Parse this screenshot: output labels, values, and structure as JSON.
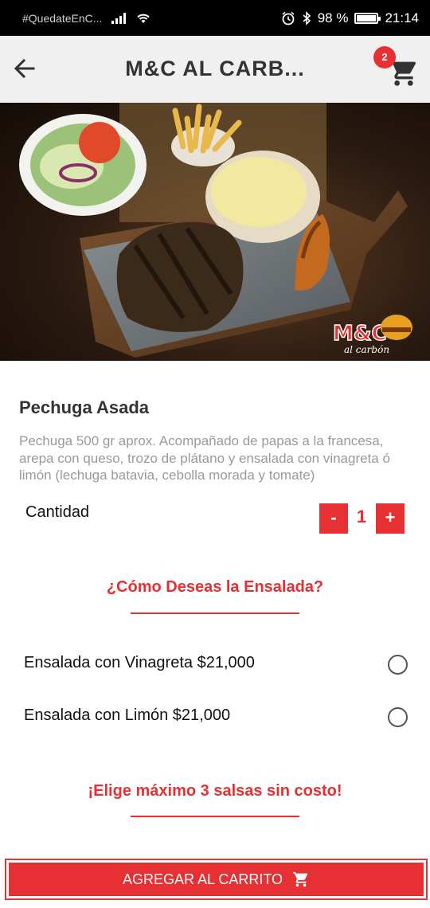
{
  "status_bar": {
    "carrier": "#QuedateEnC...",
    "battery": "98 %",
    "battery_level": 0.98,
    "time": "21:14"
  },
  "app_bar": {
    "title": "M&C AL CARB...",
    "cart_count": "2"
  },
  "product": {
    "name": "Pechuga Asada",
    "description": "Pechuga 500 gr aprox. Acompañado de papas a la francesa, arepa con queso, trozo de plátano y ensalada con vinagreta ó limón (lechuga batavia, cebolla morada y tomate)",
    "image_logo_text": "M&C",
    "image_logo_sub": "al carbón"
  },
  "quantity": {
    "label": "Cantidad",
    "minus_label": "-",
    "plus_label": "+",
    "value": "1"
  },
  "salad_section": {
    "title": "¿Cómo Deseas la Ensalada?",
    "options": [
      {
        "label": "Ensalada con Vinagreta $21,000",
        "selected": false
      },
      {
        "label": "Ensalada con Limón $21,000",
        "selected": false
      }
    ]
  },
  "sauce_section": {
    "title": "¡Elige máximo 3 salsas sin costo!"
  },
  "add_to_cart": {
    "label": "AGREGAR AL CARRITO",
    "icon": "cart-icon"
  },
  "colors": {
    "accent": "#e63033",
    "appbar_bg": "#f0f0f0",
    "status_bg": "#000000"
  }
}
